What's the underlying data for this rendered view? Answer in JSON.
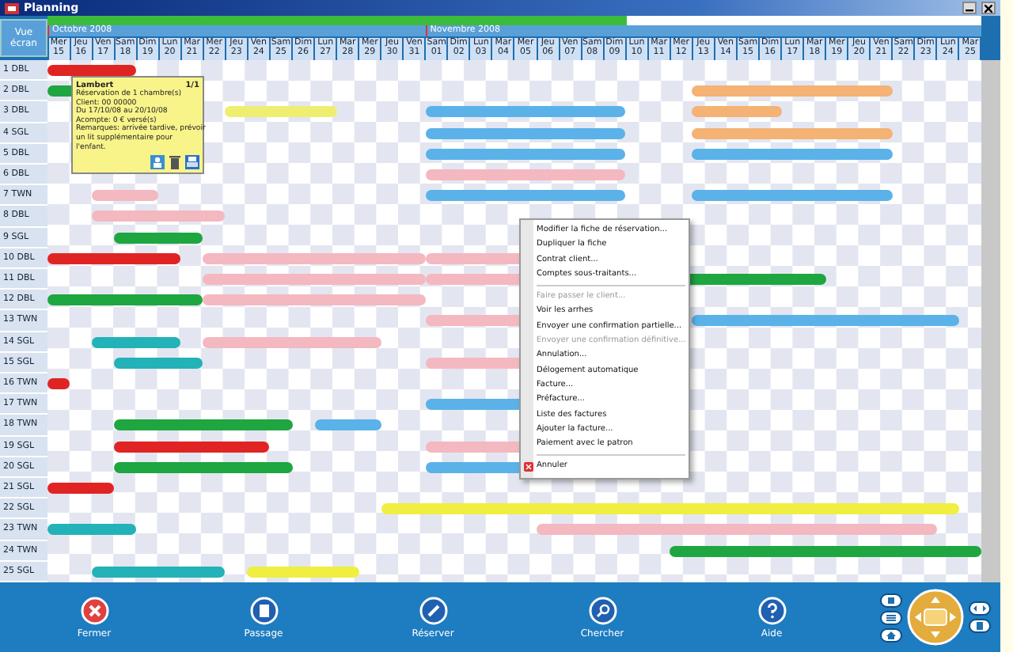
{
  "window": {
    "title": "Planning"
  },
  "view_button": {
    "label": "Vue écran"
  },
  "occupancy": {
    "level": 0.62
  },
  "months": [
    {
      "label": "Octobre 2008"
    },
    {
      "label": "Novembre 2008"
    }
  ],
  "days": [
    {
      "name": "Mer",
      "date": "15"
    },
    {
      "name": "Jeu",
      "date": "16"
    },
    {
      "name": "Ven",
      "date": "17"
    },
    {
      "name": "Sam",
      "date": "18"
    },
    {
      "name": "Dim",
      "date": "19"
    },
    {
      "name": "Lun",
      "date": "20"
    },
    {
      "name": "Mar",
      "date": "21"
    },
    {
      "name": "Mer",
      "date": "22"
    },
    {
      "name": "Jeu",
      "date": "23"
    },
    {
      "name": "Ven",
      "date": "24"
    },
    {
      "name": "Sam",
      "date": "25"
    },
    {
      "name": "Dim",
      "date": "26"
    },
    {
      "name": "Lun",
      "date": "27"
    },
    {
      "name": "Mar",
      "date": "28"
    },
    {
      "name": "Mer",
      "date": "29"
    },
    {
      "name": "Jeu",
      "date": "30"
    },
    {
      "name": "Ven",
      "date": "31"
    },
    {
      "name": "Sam",
      "date": "01"
    },
    {
      "name": "Dim",
      "date": "02"
    },
    {
      "name": "Lun",
      "date": "03"
    },
    {
      "name": "Mar",
      "date": "04"
    },
    {
      "name": "Mer",
      "date": "05"
    },
    {
      "name": "Jeu",
      "date": "06"
    },
    {
      "name": "Ven",
      "date": "07"
    },
    {
      "name": "Sam",
      "date": "08"
    },
    {
      "name": "Dim",
      "date": "09"
    },
    {
      "name": "Lun",
      "date": "10"
    },
    {
      "name": "Mar",
      "date": "11"
    },
    {
      "name": "Mer",
      "date": "12"
    },
    {
      "name": "Jeu",
      "date": "13"
    },
    {
      "name": "Ven",
      "date": "14"
    },
    {
      "name": "Sam",
      "date": "15"
    },
    {
      "name": "Dim",
      "date": "16"
    },
    {
      "name": "Lun",
      "date": "17"
    },
    {
      "name": "Mar",
      "date": "18"
    },
    {
      "name": "Mer",
      "date": "19"
    },
    {
      "name": "Jeu",
      "date": "20"
    },
    {
      "name": "Ven",
      "date": "21"
    },
    {
      "name": "Sam",
      "date": "22"
    },
    {
      "name": "Dim",
      "date": "23"
    },
    {
      "name": "Lun",
      "date": "24"
    },
    {
      "name": "Mar",
      "date": "25"
    }
  ],
  "rooms": [
    {
      "number": "1",
      "type": "DBL",
      "bookings": [
        {
          "color": "#e02424"
        }
      ]
    },
    {
      "number": "2",
      "type": "DBL",
      "bookings": [
        {
          "color": "#1ea640"
        },
        {
          "color": "#f4b274"
        }
      ]
    },
    {
      "number": "3",
      "type": "DBL",
      "bookings": [
        {
          "color": "#f0ee70"
        },
        {
          "color": "#5ab2e8"
        },
        {
          "color": "#f4b274"
        }
      ]
    },
    {
      "number": "4",
      "type": "SGL",
      "bookings": [
        {
          "color": "#5ab2e8"
        },
        {
          "color": "#f4b274"
        }
      ]
    },
    {
      "number": "5",
      "type": "DBL",
      "bookings": [
        {
          "color": "#5ab2e8"
        },
        {
          "color": "#5ab2e8"
        }
      ]
    },
    {
      "number": "6",
      "type": "DBL",
      "bookings": [
        {
          "color": "#f4b8c0"
        }
      ]
    },
    {
      "number": "7",
      "type": "TWN",
      "bookings": [
        {
          "color": "#f4b8c0"
        },
        {
          "color": "#5ab2e8"
        },
        {
          "color": "#5ab2e8"
        }
      ]
    },
    {
      "number": "8",
      "type": "DBL",
      "bookings": [
        {
          "color": "#f4b8c0"
        }
      ]
    },
    {
      "number": "9",
      "type": "SGL",
      "bookings": [
        {
          "color": "#1ea640"
        }
      ]
    },
    {
      "number": "10",
      "type": "DBL",
      "bookings": [
        {
          "color": "#e02424"
        },
        {
          "color": "#f4b8c0"
        },
        {
          "color": "#f4b8c0"
        }
      ]
    },
    {
      "number": "11",
      "type": "DBL",
      "bookings": [
        {
          "color": "#f4b8c0"
        },
        {
          "color": "#f4b8c0"
        },
        {
          "color": "#1ea640"
        }
      ]
    },
    {
      "number": "12",
      "type": "DBL",
      "bookings": [
        {
          "color": "#1ea640"
        },
        {
          "color": "#f4b8c0"
        }
      ]
    },
    {
      "number": "13",
      "type": "TWN",
      "bookings": [
        {
          "color": "#f4b8c0"
        },
        {
          "color": "#5ab2e8"
        }
      ]
    },
    {
      "number": "14",
      "type": "SGL",
      "bookings": [
        {
          "color": "#22b2b8"
        },
        {
          "color": "#f4b8c0"
        }
      ]
    },
    {
      "number": "15",
      "type": "SGL",
      "bookings": [
        {
          "color": "#22b2b8"
        },
        {
          "color": "#f4b8c0"
        }
      ]
    },
    {
      "number": "16",
      "type": "TWN",
      "bookings": [
        {
          "color": "#e02424"
        }
      ]
    },
    {
      "number": "17",
      "type": "TWN",
      "bookings": [
        {
          "color": "#5ab2e8"
        }
      ]
    },
    {
      "number": "18",
      "type": "TWN",
      "bookings": [
        {
          "color": "#1ea640"
        },
        {
          "color": "#5ab2e8"
        }
      ]
    },
    {
      "number": "19",
      "type": "SGL",
      "bookings": [
        {
          "color": "#e02424"
        },
        {
          "color": "#f4b8c0"
        }
      ]
    },
    {
      "number": "20",
      "type": "SGL",
      "bookings": [
        {
          "color": "#1ea640"
        },
        {
          "color": "#5ab2e8"
        }
      ]
    },
    {
      "number": "21",
      "type": "SGL",
      "bookings": [
        {
          "color": "#e02424"
        }
      ]
    },
    {
      "number": "22",
      "type": "SGL",
      "bookings": [
        {
          "color": "#f0ee40"
        }
      ]
    },
    {
      "number": "23",
      "type": "TWN",
      "bookings": [
        {
          "color": "#22b2b8"
        },
        {
          "color": "#f4b8c0"
        }
      ]
    },
    {
      "number": "24",
      "type": "TWN",
      "bookings": [
        {
          "color": "#1ea640"
        }
      ]
    },
    {
      "number": "25",
      "type": "SGL",
      "bookings": [
        {
          "color": "#22b2b8"
        },
        {
          "color": "#f0ee40"
        }
      ]
    }
  ],
  "tooltip": {
    "title": "Lambert",
    "count": "1/1",
    "lines": [
      "Réservation de 1 chambre(s)",
      "Client: 00 00000",
      "Du 17/10/08 au 20/10/08",
      "Acompte: 0 € versé(s)",
      "Remarques: arrivée tardive, prévoir",
      "un lit supplémentaire pour",
      "l'enfant."
    ]
  },
  "context_menu": [
    {
      "label": "Modifier la fiche de réservation...",
      "disabled": false,
      "kind": "item"
    },
    {
      "label": "Dupliquer la fiche",
      "disabled": false,
      "kind": "item"
    },
    {
      "label": "Contrat client...",
      "disabled": false,
      "kind": "item"
    },
    {
      "label": "Comptes sous-traitants...",
      "disabled": false,
      "kind": "item"
    },
    {
      "kind": "separator"
    },
    {
      "label": "Faire passer le client...",
      "disabled": true,
      "kind": "item"
    },
    {
      "label": "Voir les arrhes",
      "disabled": false,
      "kind": "item"
    },
    {
      "label": "Envoyer une confirmation partielle...",
      "disabled": false,
      "kind": "item"
    },
    {
      "label": "Envoyer une confirmation définitive...",
      "disabled": true,
      "kind": "item"
    },
    {
      "label": "Annulation...",
      "disabled": false,
      "kind": "item"
    },
    {
      "label": "Délogement automatique",
      "disabled": false,
      "kind": "item"
    },
    {
      "label": "Facture...",
      "disabled": false,
      "kind": "item"
    },
    {
      "label": "Préfacture...",
      "disabled": false,
      "kind": "item"
    },
    {
      "label": "Liste des factures",
      "disabled": false,
      "kind": "item"
    },
    {
      "label": "Ajouter la facture...",
      "disabled": false,
      "kind": "item"
    },
    {
      "label": "Paiement avec le patron",
      "disabled": false,
      "kind": "item"
    },
    {
      "kind": "separator"
    },
    {
      "label": "Annuler",
      "disabled": false,
      "kind": "cancel"
    }
  ],
  "toolbar": [
    {
      "label": "Fermer",
      "kind": "close"
    },
    {
      "label": "Passage",
      "kind": "passage"
    },
    {
      "label": "Réserver",
      "kind": "book"
    },
    {
      "label": "Chercher",
      "kind": "search"
    },
    {
      "label": "Aide",
      "kind": "help"
    }
  ]
}
